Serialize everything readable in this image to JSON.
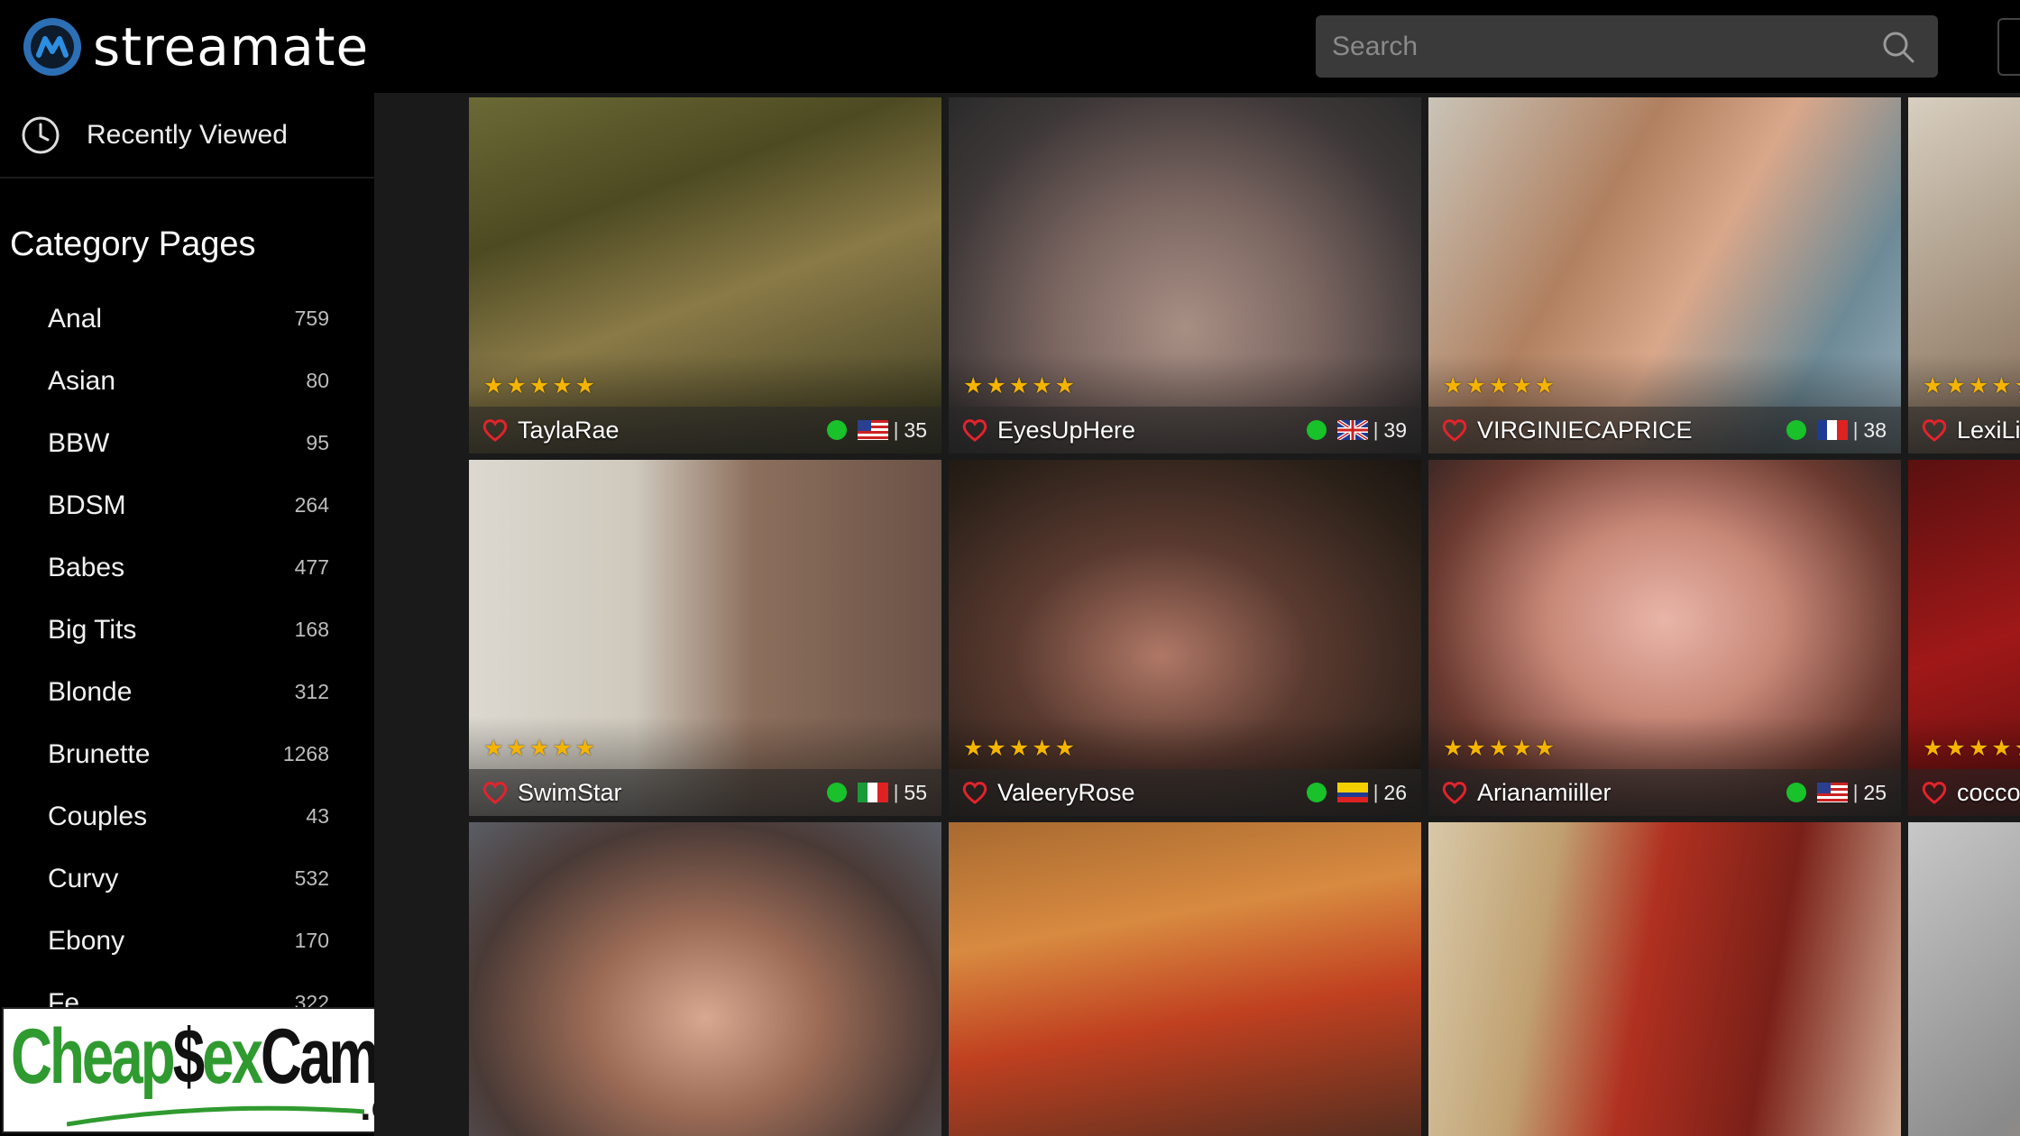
{
  "brand": {
    "name": "streamate"
  },
  "search": {
    "placeholder": "Search"
  },
  "sidebar": {
    "recent_label": "Recently Viewed",
    "category_title": "Category Pages",
    "categories": [
      {
        "name": "Anal",
        "count": "759"
      },
      {
        "name": "Asian",
        "count": "80"
      },
      {
        "name": "BBW",
        "count": "95"
      },
      {
        "name": "BDSM",
        "count": "264"
      },
      {
        "name": "Babes",
        "count": "477"
      },
      {
        "name": "Big Tits",
        "count": "168"
      },
      {
        "name": "Blonde",
        "count": "312"
      },
      {
        "name": "Brunette",
        "count": "1268"
      },
      {
        "name": "Couples",
        "count": "43"
      },
      {
        "name": "Curvy",
        "count": "532"
      },
      {
        "name": "Ebony",
        "count": "170"
      },
      {
        "name": "Fe",
        "count": "322"
      }
    ]
  },
  "promo": {
    "logo_text": "CheapSexCams.com"
  },
  "grid": {
    "models": [
      {
        "name": "TaylaRae",
        "age": "35",
        "flag": "us-flag",
        "online": true
      },
      {
        "name": "EyesUpHere",
        "age": "39",
        "flag": "uk-flag",
        "online": true
      },
      {
        "name": "VIRGINIECAPRICE",
        "age": "38",
        "flag": "france-flag",
        "online": true
      },
      {
        "name": "LexiLi",
        "age": "",
        "flag": "",
        "online": false
      },
      {
        "name": "SwimStar",
        "age": "55",
        "flag": "italy-flag",
        "online": true
      },
      {
        "name": "ValeeryRose",
        "age": "26",
        "flag": "colombia-flag",
        "online": true
      },
      {
        "name": "Arianamiiller",
        "age": "25",
        "flag": "us-flag",
        "online": true
      },
      {
        "name": "cocco",
        "age": "",
        "flag": "",
        "online": false
      },
      {
        "name": "",
        "age": "",
        "flag": "",
        "online": false
      },
      {
        "name": "",
        "age": "",
        "flag": "",
        "online": false
      },
      {
        "name": "",
        "age": "",
        "flag": "",
        "online": false
      },
      {
        "name": "",
        "age": "",
        "flag": "",
        "online": false
      }
    ],
    "rating_stars": "★★★★★",
    "separator": "|"
  },
  "colors": {
    "accent_star": "#f5b400",
    "online": "#19c12a",
    "heart": "#e3232c",
    "brand_blue": "#2c6fb5"
  }
}
